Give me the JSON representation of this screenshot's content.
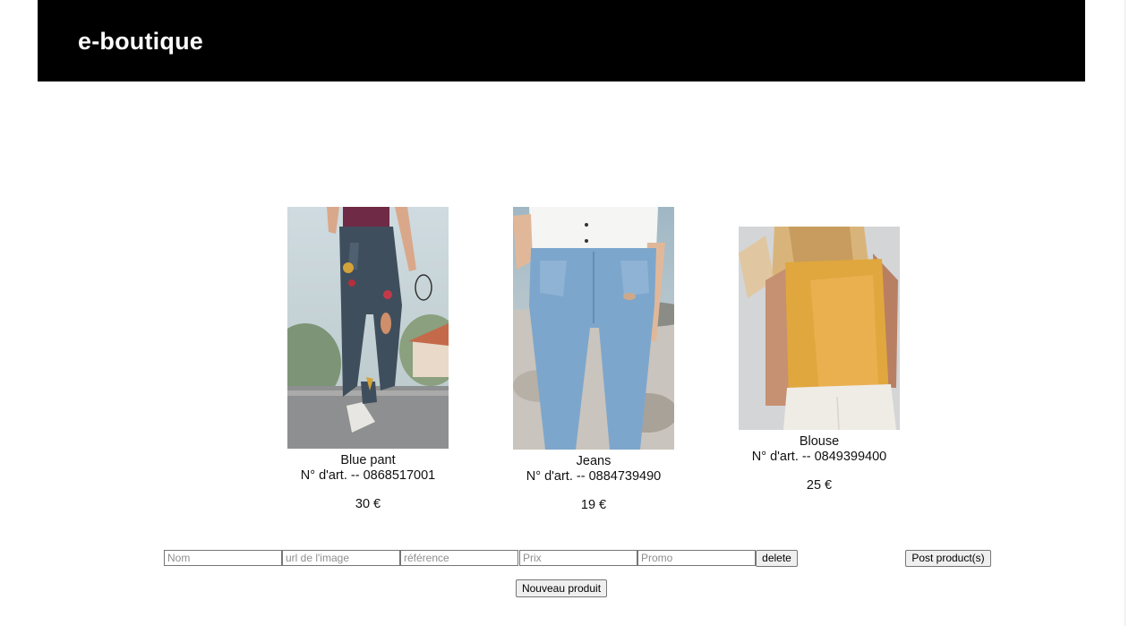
{
  "header": {
    "title": "e-boutique"
  },
  "products": [
    {
      "name": "Blue pant",
      "ref": "N° d'art. -- 0868517001",
      "price": "30 €",
      "image_icon": "woman-in-ripped-jeans-photo"
    },
    {
      "name": "Jeans",
      "ref": "N° d'art. -- 0884739490",
      "price": "19 €",
      "image_icon": "light-blue-jeans-photo"
    },
    {
      "name": "Blouse",
      "ref": "N° d'art. -- 0849399400",
      "price": "25 €",
      "image_icon": "yellow-blouse-back-photo"
    }
  ],
  "form": {
    "name_placeholder": "Nom",
    "image_placeholder": "url de l'image",
    "reference_placeholder": "référence",
    "price_placeholder": "Prix",
    "promo_placeholder": "Promo",
    "delete_label": "delete",
    "post_label": "Post product(s)",
    "new_label": "Nouveau produit"
  }
}
